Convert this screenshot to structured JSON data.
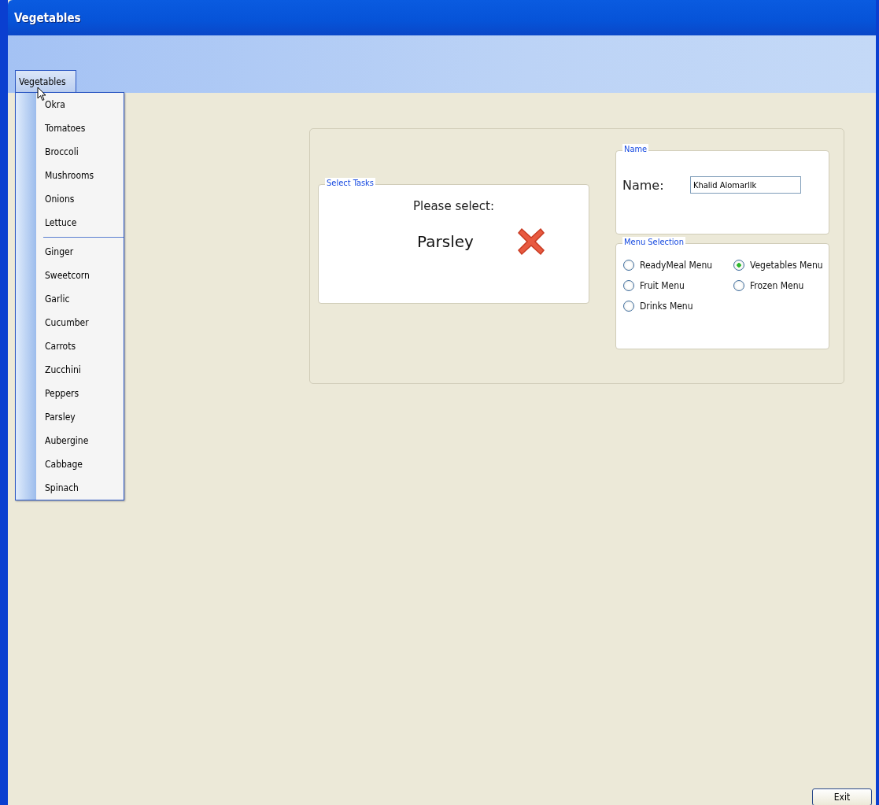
{
  "window": {
    "title": "Vegetables"
  },
  "menu": {
    "label": "Vegetables",
    "groups": [
      {
        "items": [
          "Okra",
          "Tomatoes",
          "Broccoli",
          "Mushrooms",
          "Onions",
          "Lettuce"
        ]
      },
      {
        "items": [
          "Ginger",
          "Sweetcorn",
          "Garlic",
          "Cucumber",
          "Carrots",
          "Zucchini",
          "Peppers",
          "Parsley",
          "Aubergine",
          "Cabbage",
          "Spinach"
        ]
      }
    ]
  },
  "select_tasks": {
    "title": "Select Tasks",
    "prompt": "Please select:",
    "choice": "Parsley"
  },
  "name_group": {
    "title": "Name",
    "label": "Name:",
    "value": "Khalid Alomarllk"
  },
  "menu_selection": {
    "title": "Menu Selection",
    "options": [
      {
        "label": "ReadyMeal Menu",
        "selected": false
      },
      {
        "label": "Vegetables Menu",
        "selected": true
      },
      {
        "label": "Fruit Menu",
        "selected": false
      },
      {
        "label": "Frozen Menu",
        "selected": false
      },
      {
        "label": "Drinks Menu",
        "selected": false
      }
    ]
  },
  "exit_button": "Exit"
}
